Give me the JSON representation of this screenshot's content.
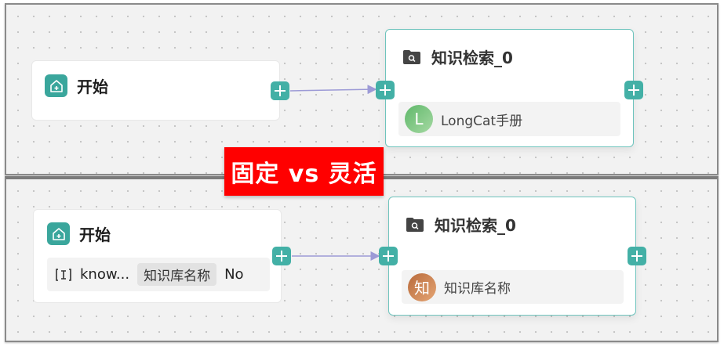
{
  "banner": "固定 vs 灵活",
  "top": {
    "start_node": {
      "title": "开始",
      "icon": "home-plus-icon"
    },
    "knowledge_node": {
      "title": "知识检索_0",
      "icon": "folder-search-icon",
      "kb_item": {
        "avatar_letter": "L",
        "name": "LongCat手册"
      }
    }
  },
  "bottom": {
    "start_node": {
      "title": "开始",
      "icon": "home-plus-icon",
      "param": {
        "name": "know...",
        "type_tag": "知识库名称",
        "required": "No",
        "icon": "variable-icon"
      }
    },
    "knowledge_node": {
      "title": "知识检索_0",
      "icon": "folder-search-icon",
      "kb_item": {
        "avatar_letter": "知",
        "name": "知识库名称"
      }
    }
  },
  "colors": {
    "accent": "#43b0a6",
    "banner": "#ff0000",
    "edge": "#9c9ad6"
  }
}
